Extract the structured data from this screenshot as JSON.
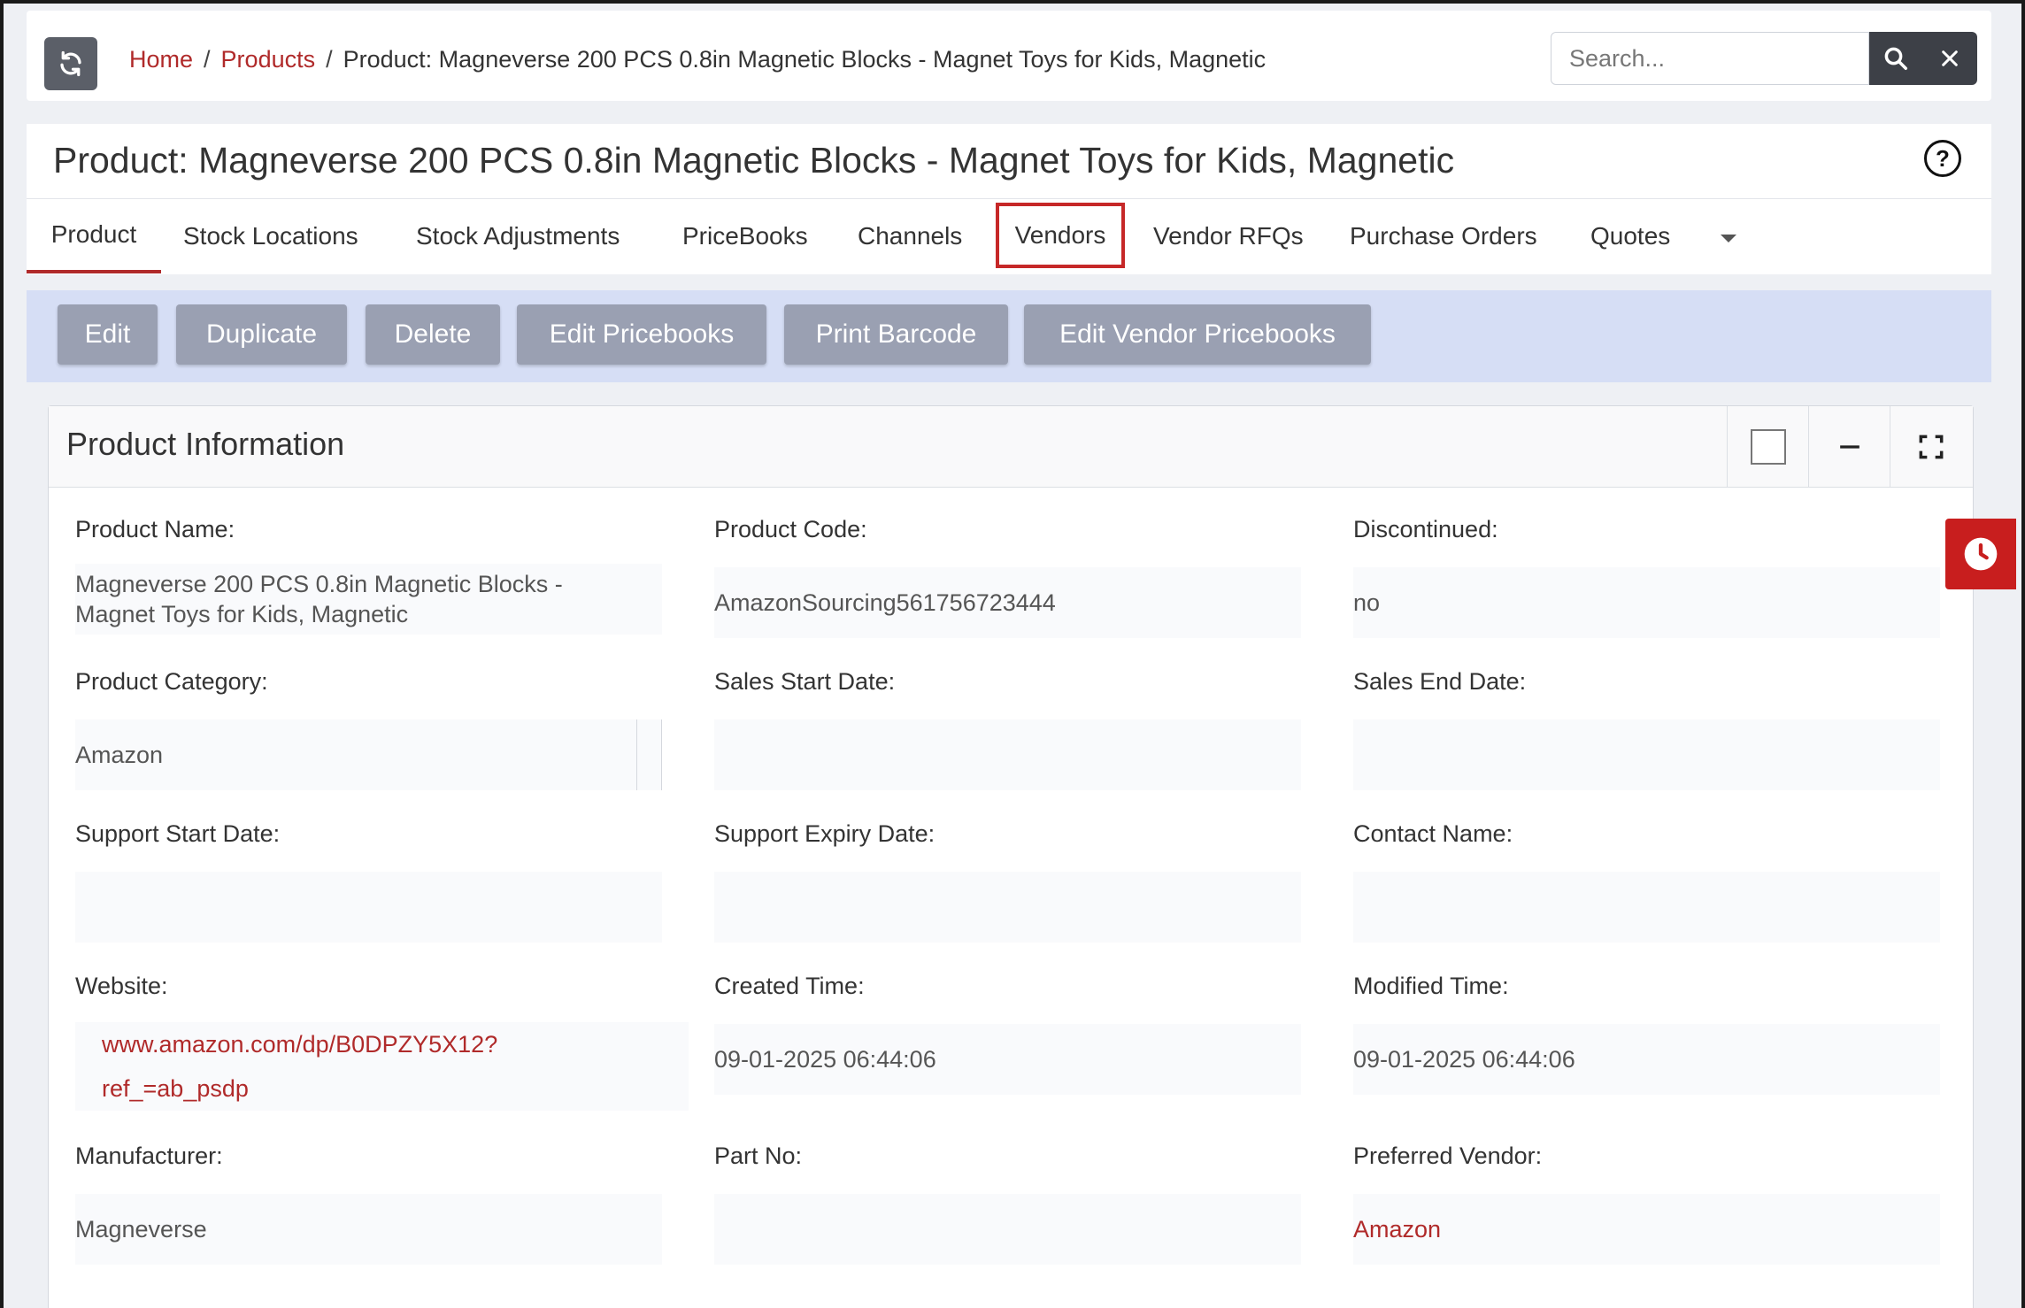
{
  "breadcrumb": {
    "home": "Home",
    "products": "Products",
    "current": "Product: Magneverse 200 PCS 0.8in Magnetic Blocks - Magnet Toys for Kids, Magnetic",
    "separator": "/"
  },
  "search": {
    "placeholder": "Search..."
  },
  "page": {
    "title": "Product: Magneverse 200 PCS 0.8in Magnetic Blocks - Magnet Toys for Kids, Magnetic",
    "help": "?"
  },
  "tabs": [
    {
      "label": "Product",
      "active": true
    },
    {
      "label": "Stock Locations"
    },
    {
      "label": "Stock Adjustments"
    },
    {
      "label": "PriceBooks"
    },
    {
      "label": "Channels"
    },
    {
      "label": "Vendors",
      "highlighted": true
    },
    {
      "label": "Vendor RFQs"
    },
    {
      "label": "Purchase Orders"
    },
    {
      "label": "Quotes"
    }
  ],
  "actions": {
    "edit": "Edit",
    "duplicate": "Duplicate",
    "delete": "Delete",
    "edit_pricebooks": "Edit Pricebooks",
    "print_barcode": "Print Barcode",
    "edit_vendor_pricebooks": "Edit Vendor Pricebooks"
  },
  "panel": {
    "title": "Product Information",
    "fields": {
      "product_name": {
        "label": "Product Name:",
        "value_line1": "Magneverse 200 PCS 0.8in Magnetic Blocks -",
        "value_line2": "Magnet Toys for Kids, Magnetic"
      },
      "product_code": {
        "label": "Product Code:",
        "value": "AmazonSourcing561756723444"
      },
      "discontinued": {
        "label": "Discontinued:",
        "value": "no"
      },
      "product_category": {
        "label": "Product Category:",
        "value": "Amazon"
      },
      "sales_start_date": {
        "label": "Sales Start Date:",
        "value": ""
      },
      "sales_end_date": {
        "label": "Sales End Date:",
        "value": ""
      },
      "support_start_date": {
        "label": "Support Start Date:",
        "value": ""
      },
      "support_expiry_date": {
        "label": "Support Expiry Date:",
        "value": ""
      },
      "contact_name": {
        "label": "Contact Name:",
        "value": ""
      },
      "website": {
        "label": "Website:",
        "value_line1": "www.amazon.com/dp/B0DPZY5X12?",
        "value_line2": "ref_=ab_psdp"
      },
      "created_time": {
        "label": "Created Time:",
        "value": "09-01-2025 06:44:06"
      },
      "modified_time": {
        "label": "Modified Time:",
        "value": "09-01-2025 06:44:06"
      },
      "manufacturer": {
        "label": "Manufacturer:",
        "value": "Magneverse"
      },
      "part_no": {
        "label": "Part No:",
        "value": ""
      },
      "preferred_vendor": {
        "label": "Preferred Vendor:",
        "value": "Amazon"
      }
    }
  },
  "colors": {
    "accent": "#b02a2a",
    "action_bar": "#d6def5",
    "action_button": "#9aa0b2",
    "dark_button": "#3d4047",
    "clock_button": "#c81e1e"
  },
  "icons": {
    "refresh": "refresh-icon",
    "search": "search-icon",
    "clear": "close-icon",
    "help": "help-circle-icon",
    "more_tabs": "caret-down-icon",
    "minimize": "minus-icon",
    "fullscreen": "expand-icon",
    "history": "clock-icon"
  }
}
